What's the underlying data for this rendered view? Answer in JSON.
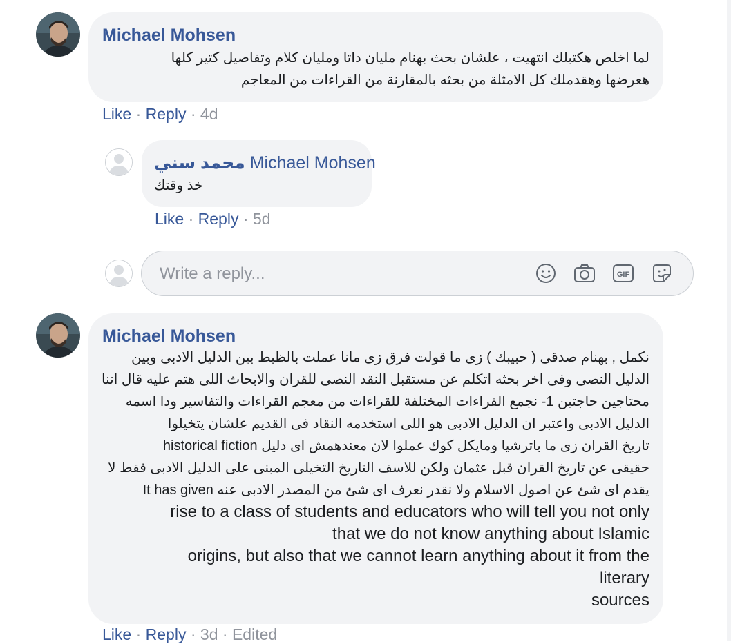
{
  "comments": [
    {
      "author": "Michael Mohsen",
      "lines": [
        "لما اخلص هكتبلك انتهيت ، علشان بحث بهنام مليان داتا ومليان كلام وتفاصيل كتير كلها",
        "هعرضها وهقدملك كل الامثلة من بحثه بالمقارنة من القراءات من المعاجم"
      ],
      "actions": {
        "like": "Like",
        "reply": "Reply",
        "time": "4d"
      }
    },
    {
      "author": "Michael Mohsen",
      "lines": [
        "نكمل , بهنام صدقى ( حبيبك ) زى ما قولت فرق زى مانا عملت بالظبط بين الدليل الادبى وبين",
        "الدليل النصى وفى اخر بحثه اتكلم عن مستقبل النقد النصى للقران والابحاث اللى هتم عليه قال اننا",
        "محتاجين حاجتين 1- نجمع القراءات المختلفة للقراءات من معجم القراءات والتفاسير ودا اسمه",
        "الدليل الادبى واعتبر ان الدليل الادبى هو اللى استخدمه النقاد فى القديم علشان يتخيلوا",
        "historical fiction تاريخ القران زى ما باترشيا ومايكل كوك عملوا لان معندهمش اى دليل",
        "حقيقى عن تاريخ القران قبل عثمان ولكن للاسف التاريخ التخيلى المبنى على الدليل الادبى فقط لا",
        "يقدم اى شئ عن اصول الاسلام ولا نقدر نعرف اى شئ من المصدر الادبى عنه It has given"
      ],
      "english_lines": [
        "rise to a class of students and educators who will tell you not only",
        "that we do not know anything about Islamic",
        "origins, but also that we cannot learn anything about it from the",
        "literary",
        "sources"
      ],
      "actions": {
        "like": "Like",
        "reply": "Reply",
        "time": "3d",
        "edited": "Edited"
      }
    }
  ],
  "reply": {
    "author_mention": "محمد سني",
    "author": "Michael Mohsen",
    "text": "خذ وقتك",
    "actions": {
      "like": "Like",
      "reply": "Reply",
      "time": "5d"
    }
  },
  "composer": {
    "placeholder": "Write a reply...",
    "icons": [
      "emoji-icon",
      "camera-icon",
      "gif-icon",
      "sticker-icon"
    ],
    "gif_label": "GIF"
  },
  "colors": {
    "link": "#385898",
    "meta": "#90949c",
    "bubble": "#f2f3f5",
    "border": "#ccd0d5"
  }
}
